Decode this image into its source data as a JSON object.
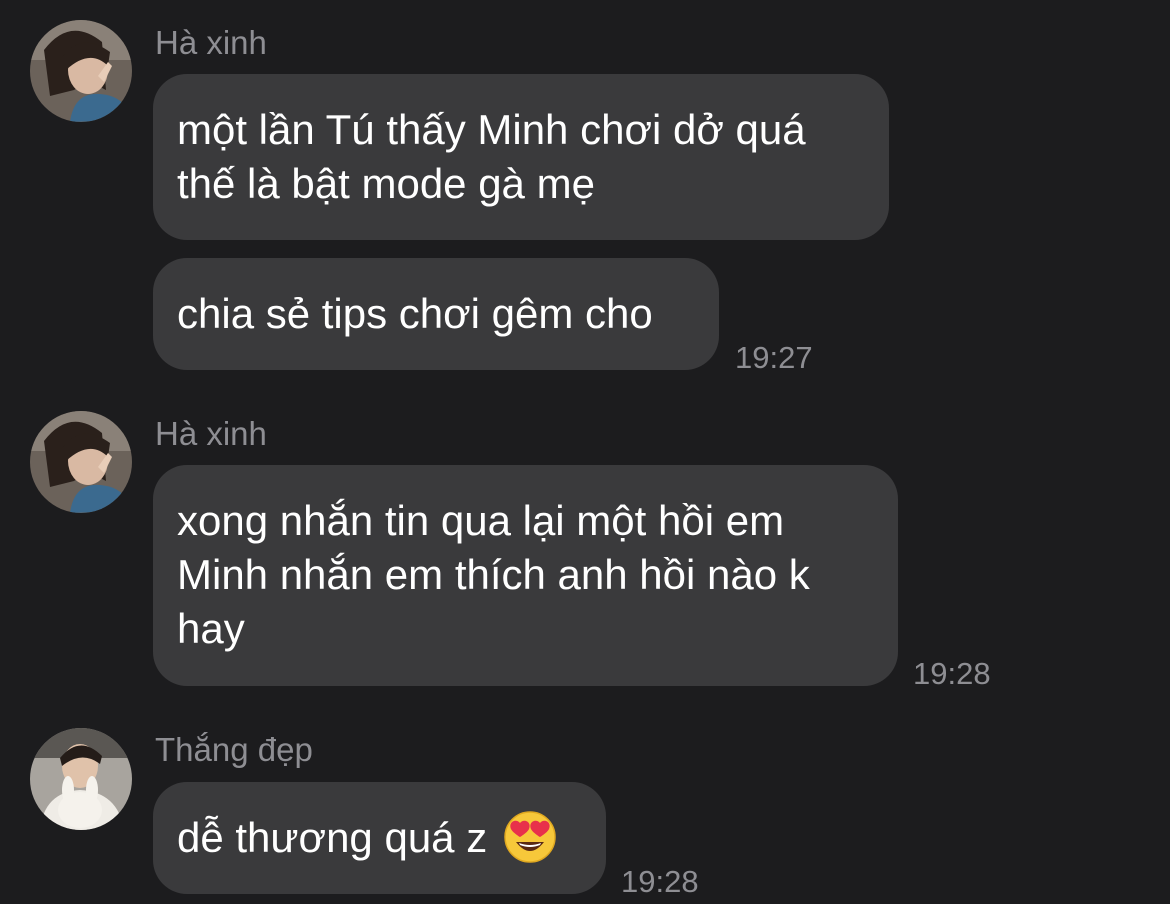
{
  "messages": [
    {
      "sender": "Hà xinh",
      "avatar": "avatar-ha-xinh",
      "bubbles": [
        "một lần Tú thấy Minh chơi dở quá\nthế là bật mode gà mẹ",
        "chia sẻ tips chơi gêm cho"
      ],
      "time": "19:27"
    },
    {
      "sender": "Hà xinh",
      "avatar": "avatar-ha-xinh",
      "bubbles": [
        "xong nhắn tin qua lại một hồi em\nMinh nhắn em thích anh hồi nào k\nhay"
      ],
      "time": "19:28"
    },
    {
      "sender": "Thắng đẹp",
      "avatar": "avatar-thang-dep",
      "bubbles": [
        "dễ thương quá z"
      ],
      "emoji": "heart-eyes-emoji",
      "time": "19:28"
    }
  ],
  "colors": {
    "background": "#1c1c1e",
    "bubble": "#3a3a3c",
    "text": "#ffffff",
    "meta": "#8e8e93"
  }
}
